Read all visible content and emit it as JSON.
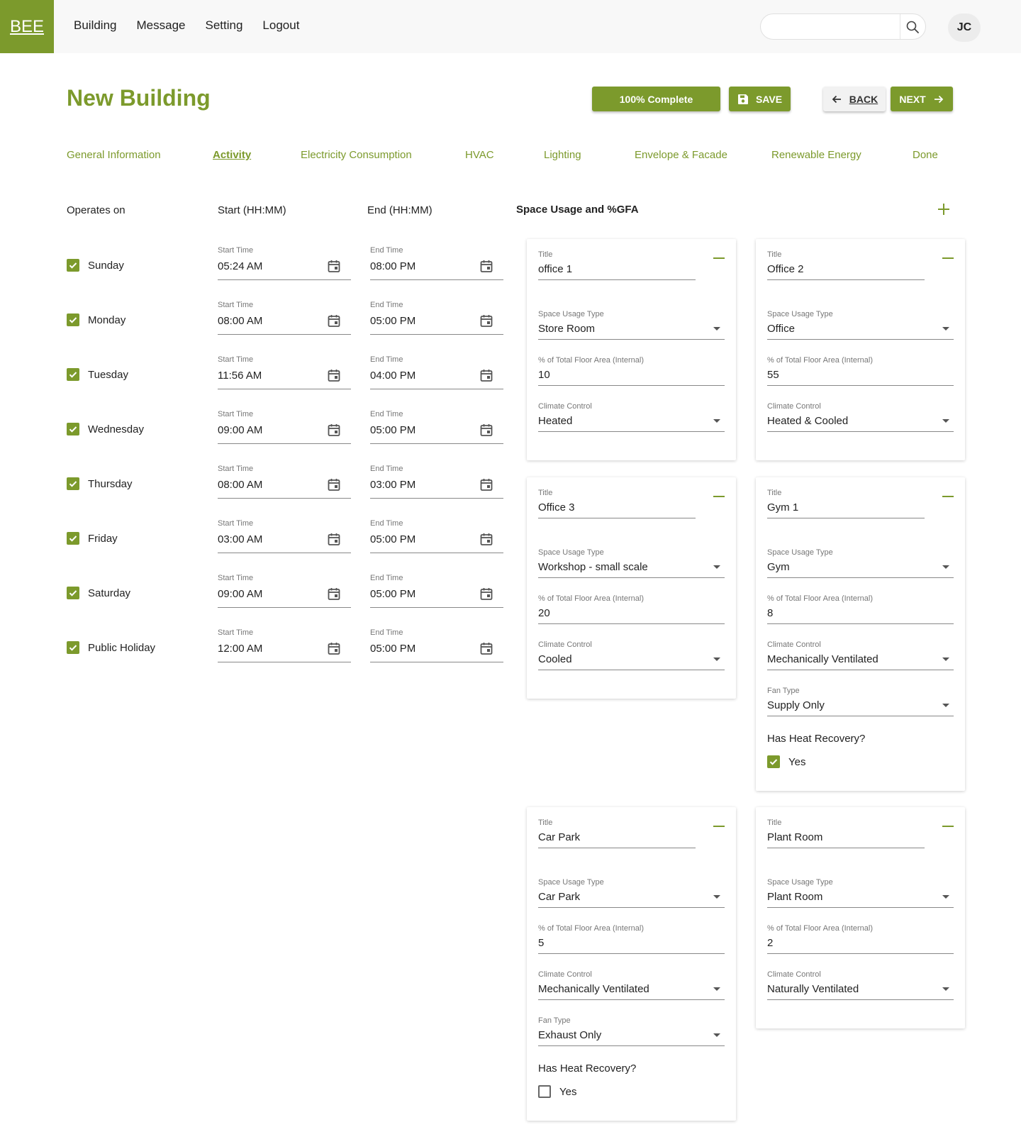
{
  "app": {
    "logo": "BEE"
  },
  "nav": {
    "items": [
      "Building",
      "Message",
      "Setting",
      "Logout"
    ]
  },
  "search": {
    "placeholder": ""
  },
  "user": {
    "initials": "JC"
  },
  "header": {
    "title": "New Building",
    "complete_label": "100% Complete",
    "save_label": "SAVE",
    "back_label": "BACK",
    "next_label": "NEXT"
  },
  "tabs": [
    {
      "label": "General Information",
      "active": false
    },
    {
      "label": "Activity",
      "active": true
    },
    {
      "label": "Electricity Consumption",
      "active": false
    },
    {
      "label": "HVAC",
      "active": false
    },
    {
      "label": "Lighting",
      "active": false
    },
    {
      "label": "Envelope & Facade",
      "active": false
    },
    {
      "label": "Renewable Energy",
      "active": false
    },
    {
      "label": "Done",
      "active": false
    }
  ],
  "schedule": {
    "operates_on_label": "Operates on",
    "start_header": "Start (HH:MM)",
    "end_header": "End (HH:MM)",
    "start_field_label": "Start Time",
    "end_field_label": "End Time",
    "days": [
      {
        "name": "Sunday",
        "checked": true,
        "start": "05:24 AM",
        "end": "08:00 PM"
      },
      {
        "name": "Monday",
        "checked": true,
        "start": "08:00 AM",
        "end": "05:00 PM"
      },
      {
        "name": "Tuesday",
        "checked": true,
        "start": "11:56 AM",
        "end": "04:00 PM"
      },
      {
        "name": "Wednesday",
        "checked": true,
        "start": "09:00 AM",
        "end": "05:00 PM"
      },
      {
        "name": "Thursday",
        "checked": true,
        "start": "08:00 AM",
        "end": "03:00 PM"
      },
      {
        "name": "Friday",
        "checked": true,
        "start": "03:00 AM",
        "end": "05:00 PM"
      },
      {
        "name": "Saturday",
        "checked": true,
        "start": "09:00 AM",
        "end": "05:00 PM"
      },
      {
        "name": "Public Holiday",
        "checked": true,
        "start": "12:00 AM",
        "end": "05:00 PM"
      }
    ]
  },
  "space_usage": {
    "heading": "Space Usage and %GFA",
    "labels": {
      "title": "Title",
      "type": "Space Usage Type",
      "gfa": "% of Total Floor Area (Internal)",
      "climate": "Climate Control",
      "fan": "Fan Type",
      "heat_recovery": "Has Heat Recovery?",
      "yes": "Yes"
    },
    "cards": [
      {
        "title": "office 1",
        "type": "Store Room",
        "gfa": "10",
        "climate": "Heated"
      },
      {
        "title": "Office 2",
        "type": "Office",
        "gfa": "55",
        "climate": "Heated & Cooled"
      },
      {
        "title": "Office 3",
        "type": "Workshop - small scale",
        "gfa": "20",
        "climate": "Cooled"
      },
      {
        "title": "Gym 1",
        "type": "Gym",
        "gfa": "8",
        "climate": "Mechanically Ventilated",
        "fan": "Supply Only",
        "heat_recovery": true
      },
      {
        "title": "Car Park",
        "type": "Car Park",
        "gfa": "5",
        "climate": "Mechanically Ventilated",
        "fan": "Exhaust Only",
        "heat_recovery": false
      },
      {
        "title": "Plant Room",
        "type": "Plant Room",
        "gfa": "2",
        "climate": "Naturally Ventilated"
      }
    ]
  },
  "colors": {
    "brand": "#7c9a2c",
    "topbar": "#f8f8f8"
  }
}
